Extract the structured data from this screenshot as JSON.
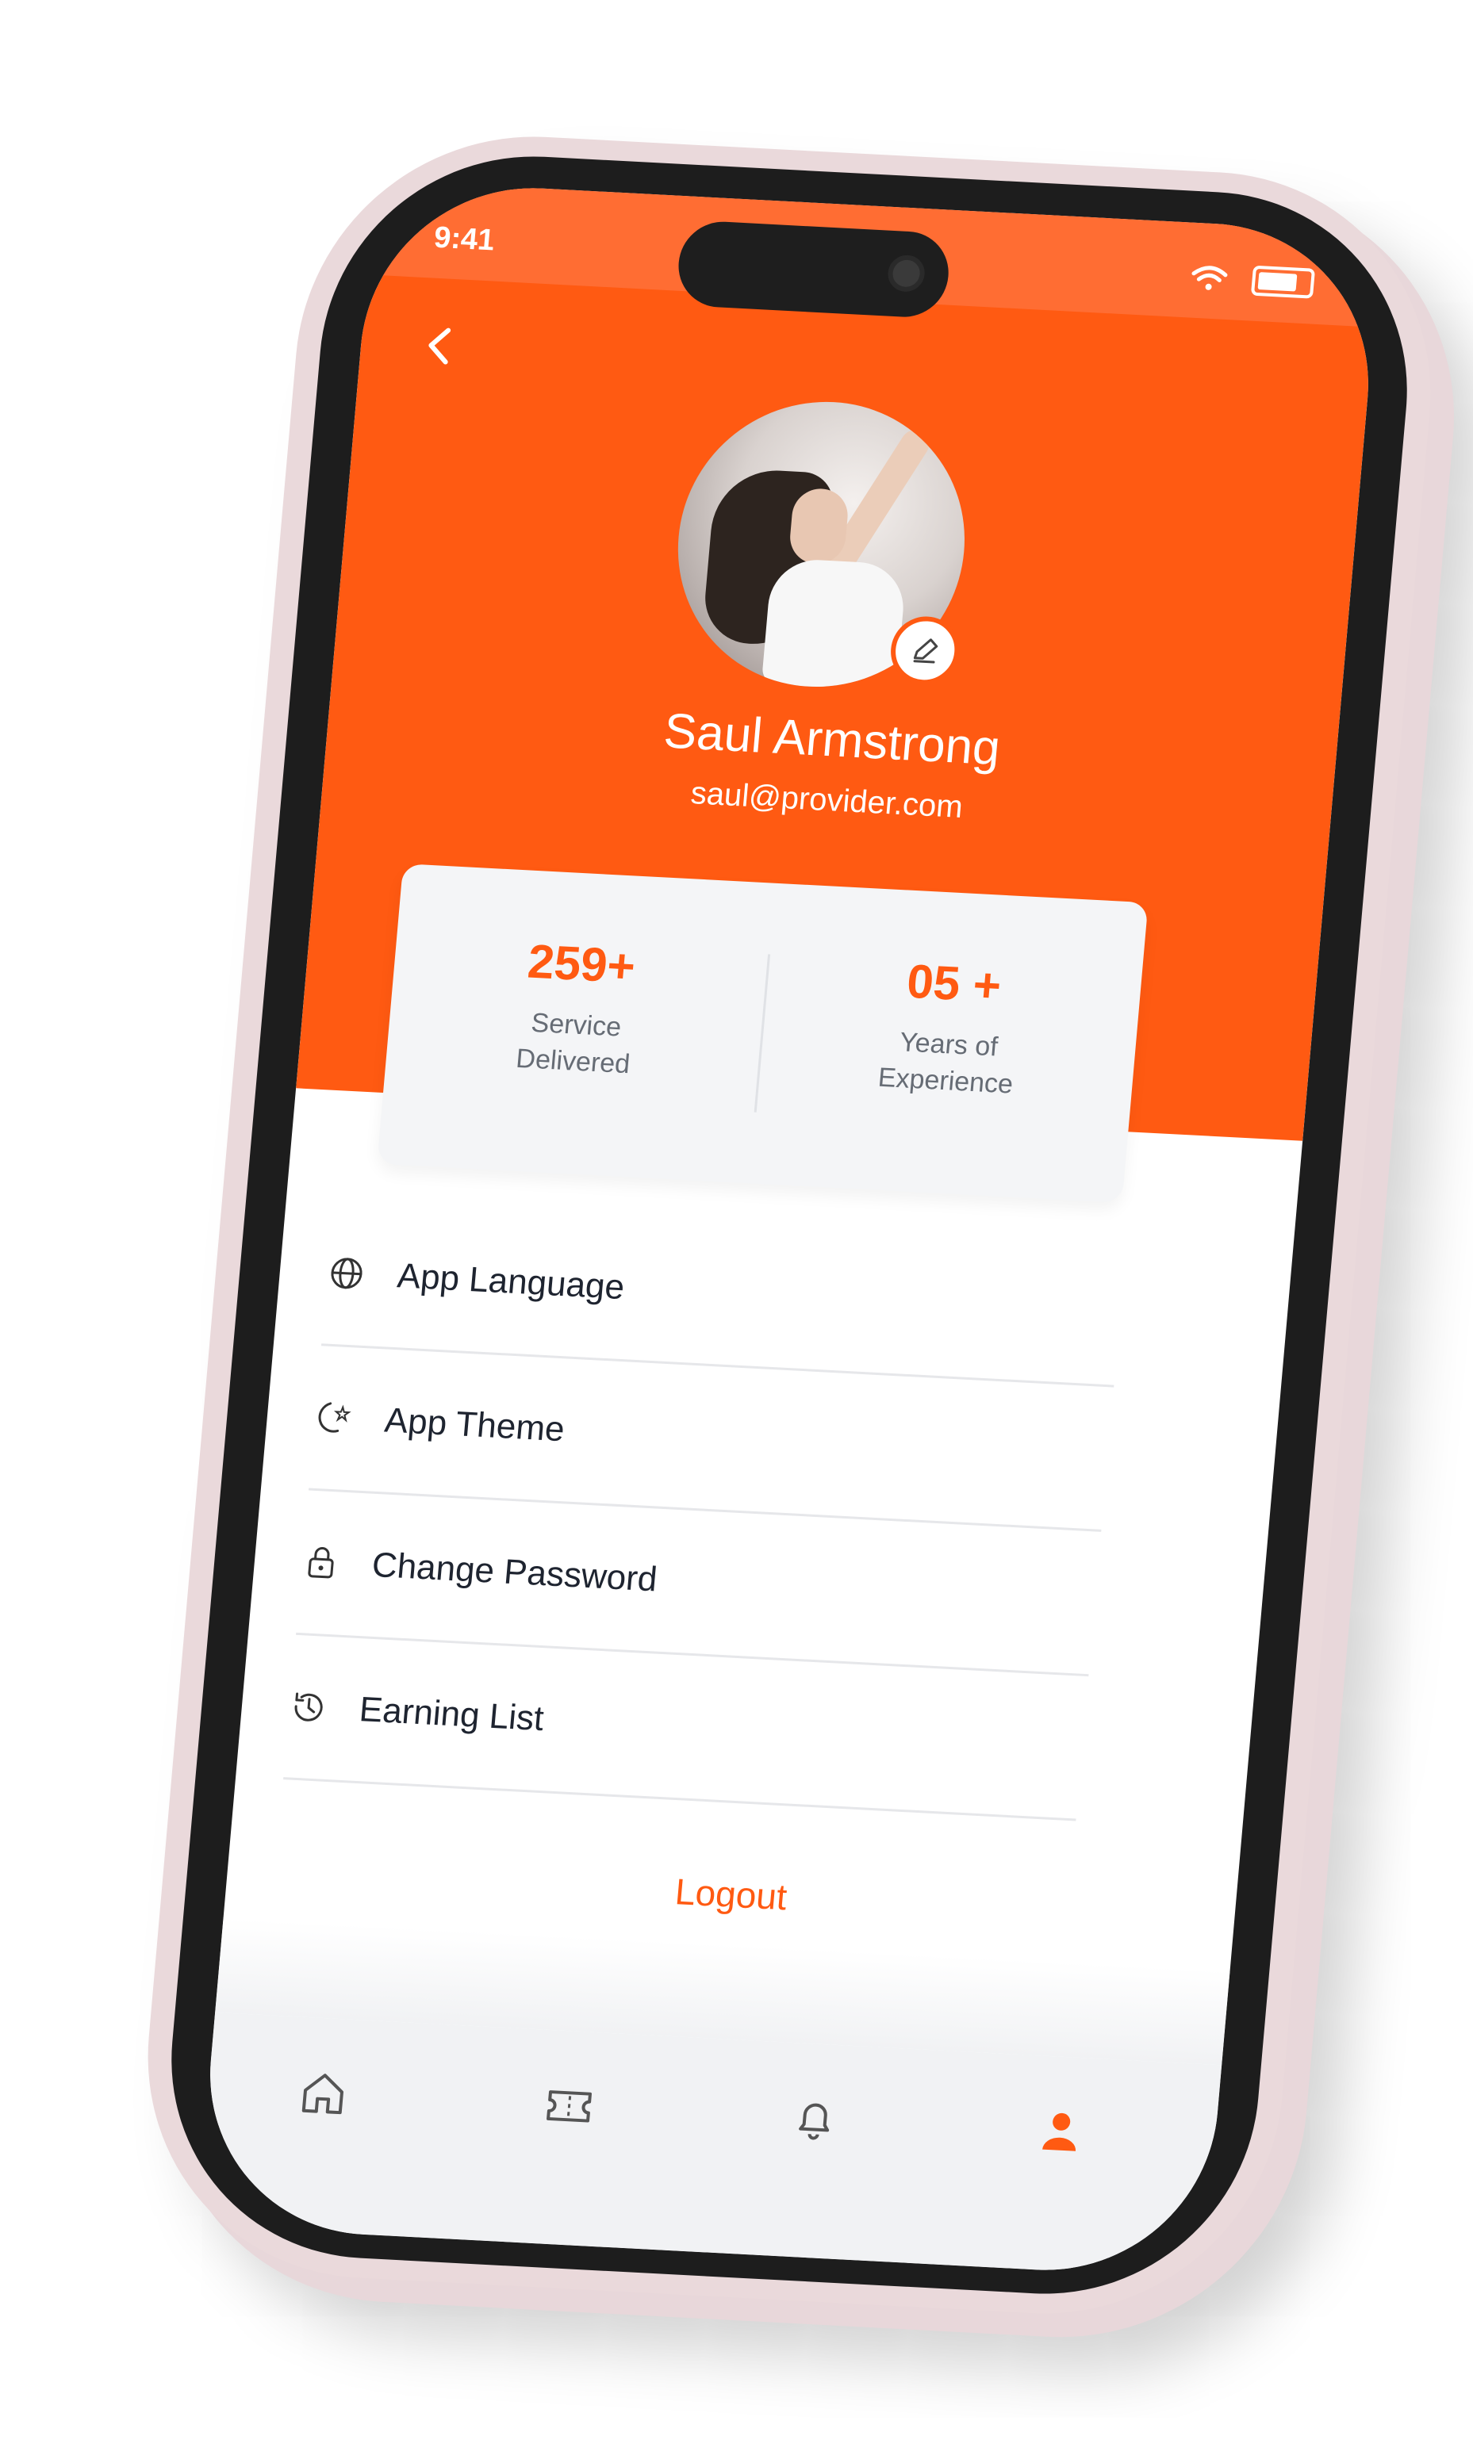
{
  "status": {
    "time": "9:41"
  },
  "profile": {
    "name": "Saul Armstrong",
    "email": "saul@provider.com"
  },
  "stats": [
    {
      "value": "259+",
      "label_line1": "Service",
      "label_line2": "Delivered"
    },
    {
      "value": "05 +",
      "label_line1": "Years of",
      "label_line2": "Experience"
    }
  ],
  "menu": [
    {
      "label": "App Language",
      "icon": "globe-icon"
    },
    {
      "label": "App Theme",
      "icon": "theme-icon"
    },
    {
      "label": "Change Password",
      "icon": "lock-icon"
    },
    {
      "label": "Earning List",
      "icon": "history-icon"
    }
  ],
  "logout_label": "Logout",
  "tabs": [
    {
      "icon": "home-icon"
    },
    {
      "icon": "ticket-icon"
    },
    {
      "icon": "bell-icon"
    },
    {
      "icon": "profile-icon",
      "active": true
    }
  ],
  "colors": {
    "accent": "#ff5a12",
    "phone_frame": "#ead9db",
    "text_dark": "#1e2430",
    "text_muted": "#666c75"
  }
}
